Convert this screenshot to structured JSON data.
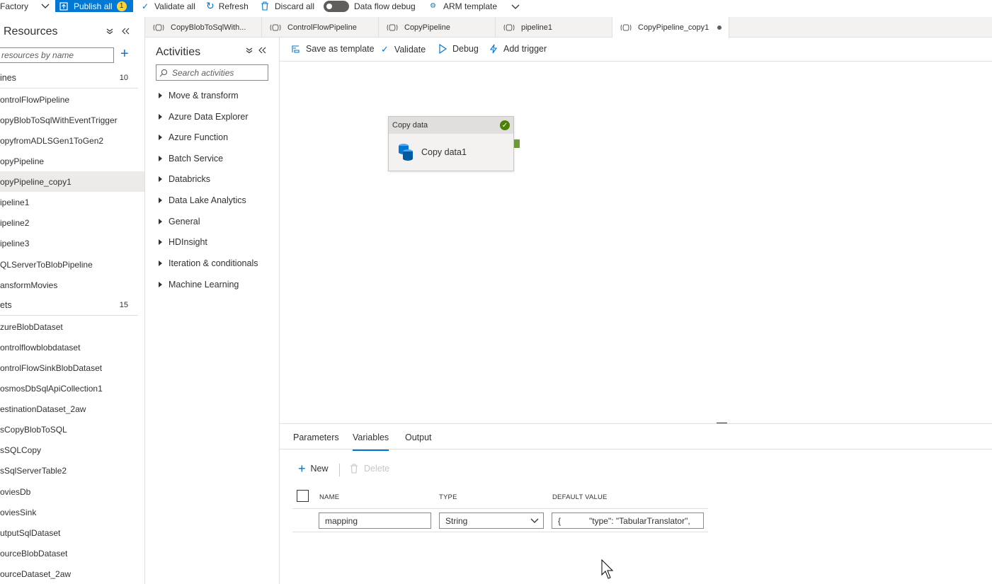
{
  "toolbar": {
    "factory_label": "Factory",
    "publish_label": "Publish all",
    "publish_count": "1",
    "validate_all": "Validate all",
    "refresh": "Refresh",
    "discard_all": "Discard all",
    "data_flow_debug": "Data flow debug",
    "arm_template": "ARM template"
  },
  "resources": {
    "title": "Resources",
    "search_placeholder": "resources by name",
    "pipelines_header": "ines",
    "pipelines_count": "10",
    "pipelines": [
      "ontrolFlowPipeline",
      "opyBlobToSqlWithEventTrigger",
      "opyfromADLSGen1ToGen2",
      "opyPipeline",
      "opyPipeline_copy1",
      "ipeline1",
      "ipeline2",
      "ipeline3",
      "QLServerToBlobPipeline",
      "ansformMovies"
    ],
    "datasets_header": "ets",
    "datasets_count": "15",
    "datasets": [
      "zureBlobDataset",
      "ontrolflowblobdataset",
      "ontrolFlowSinkBlobDataset",
      "osmosDbSqlApiCollection1",
      "estinationDataset_2aw",
      "sCopyBlobToSQL",
      "sSQLCopy",
      "sSqlServerTable2",
      "oviesDb",
      "oviesSink",
      "utputSqlDataset",
      "ourceBlobDataset",
      "ourceDataset_2aw"
    ]
  },
  "tabs": [
    {
      "label": "CopyBlobToSqlWith..."
    },
    {
      "label": "ControlFlowPipeline"
    },
    {
      "label": "CopyPipeline"
    },
    {
      "label": "pipeline1"
    },
    {
      "label": "CopyPipeline_copy1"
    }
  ],
  "activities": {
    "title": "Activities",
    "search_placeholder": "Search activities",
    "items": [
      "Move & transform",
      "Azure Data Explorer",
      "Azure Function",
      "Batch Service",
      "Databricks",
      "Data Lake Analytics",
      "General",
      "HDInsight",
      "Iteration & conditionals",
      "Machine Learning"
    ]
  },
  "canvas_toolbar": {
    "save_as_template": "Save as template",
    "validate": "Validate",
    "debug": "Debug",
    "add_trigger": "Add trigger"
  },
  "node": {
    "type_label": "Copy data",
    "name": "Copy data1"
  },
  "bottom": {
    "tabs": [
      "Parameters",
      "Variables",
      "Output"
    ],
    "new_label": "New",
    "delete_label": "Delete",
    "col_name": "NAME",
    "col_type": "TYPE",
    "col_default": "DEFAULT VALUE",
    "row": {
      "name": "mapping",
      "type": "String",
      "default_value": "{            \"type\": \"TabularTranslator\","
    }
  },
  "colors": {
    "accent": "#0078d4",
    "success": "#498205",
    "badge": "#ffd335"
  }
}
